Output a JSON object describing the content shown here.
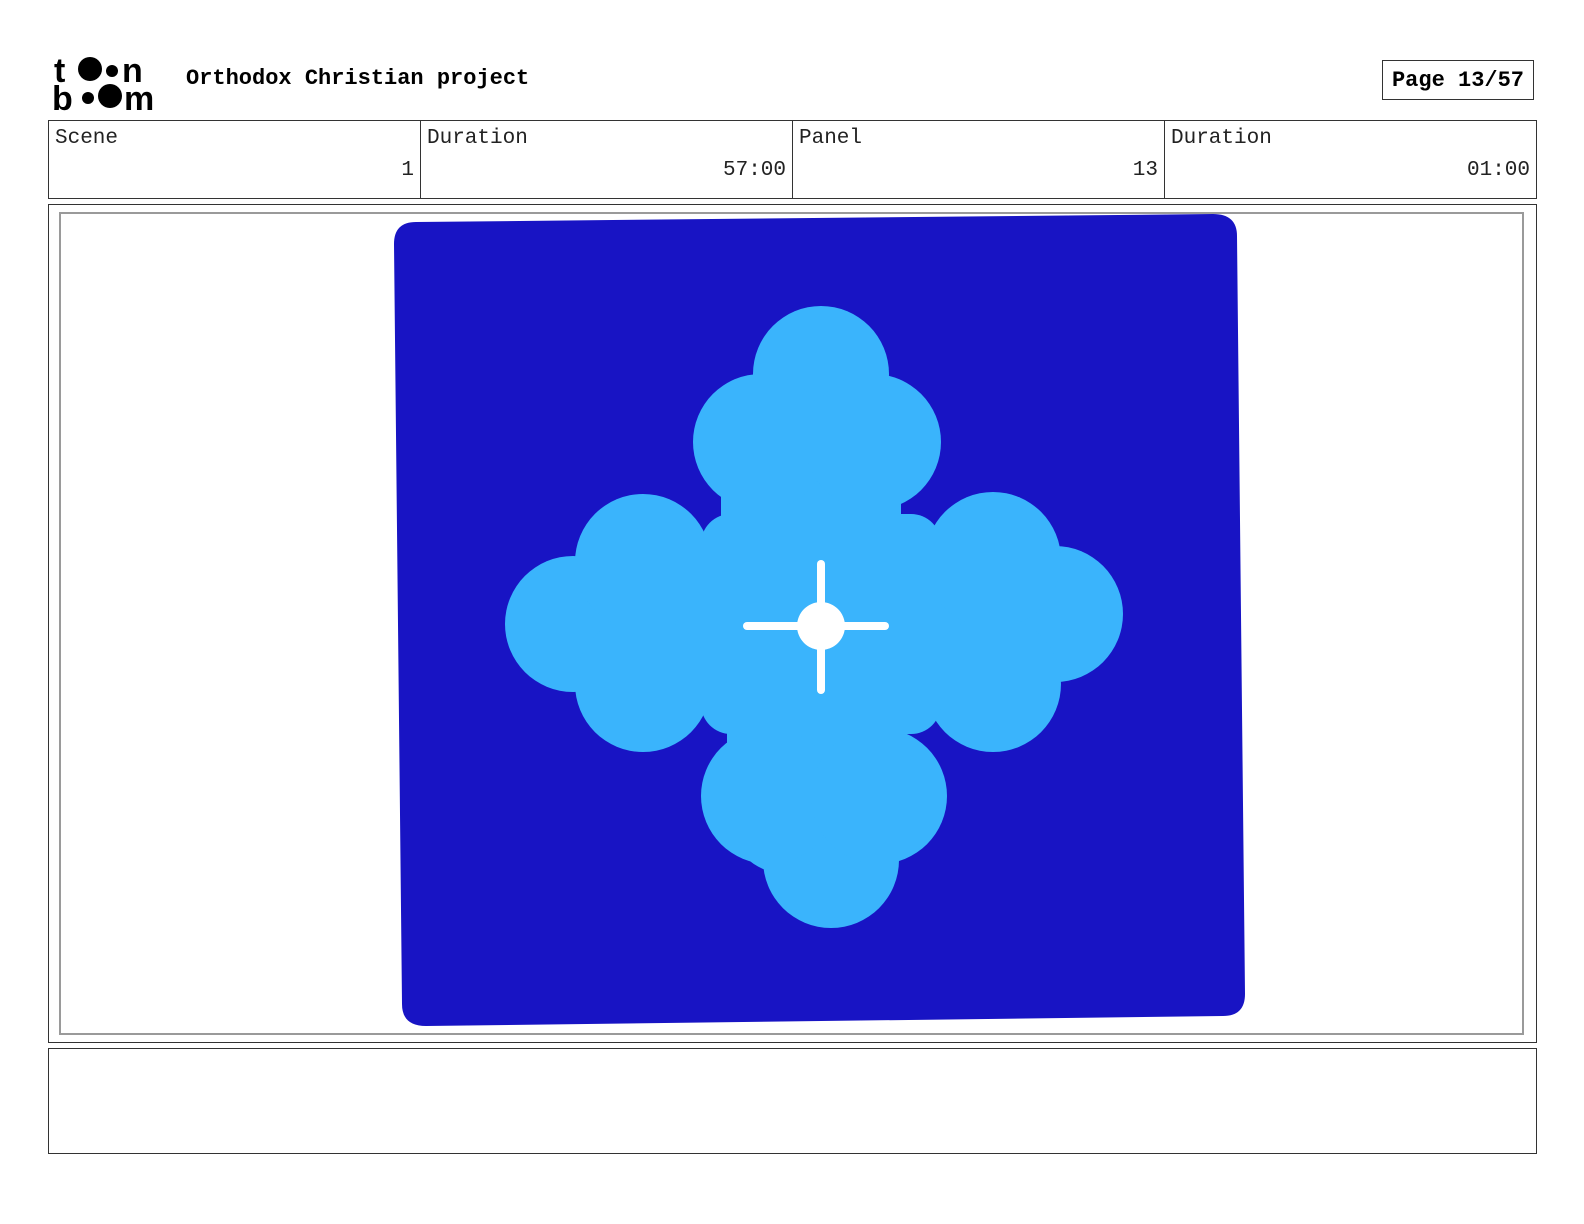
{
  "header": {
    "logo_text": "toon boom",
    "project_title": "Orthodox Christian project",
    "page_label": "Page 13/57"
  },
  "info": {
    "scene_label": "Scene",
    "scene_value": "1",
    "scene_duration_label": "Duration",
    "scene_duration_value": "57:00",
    "panel_label": "Panel",
    "panel_value": "13",
    "panel_duration_label": "Duration",
    "panel_duration_value": "01:00"
  },
  "artwork": {
    "background_color": "#1814c4",
    "cross_color": "#3ab4fc",
    "center_color": "#ffffff"
  },
  "notes": {
    "text": ""
  }
}
